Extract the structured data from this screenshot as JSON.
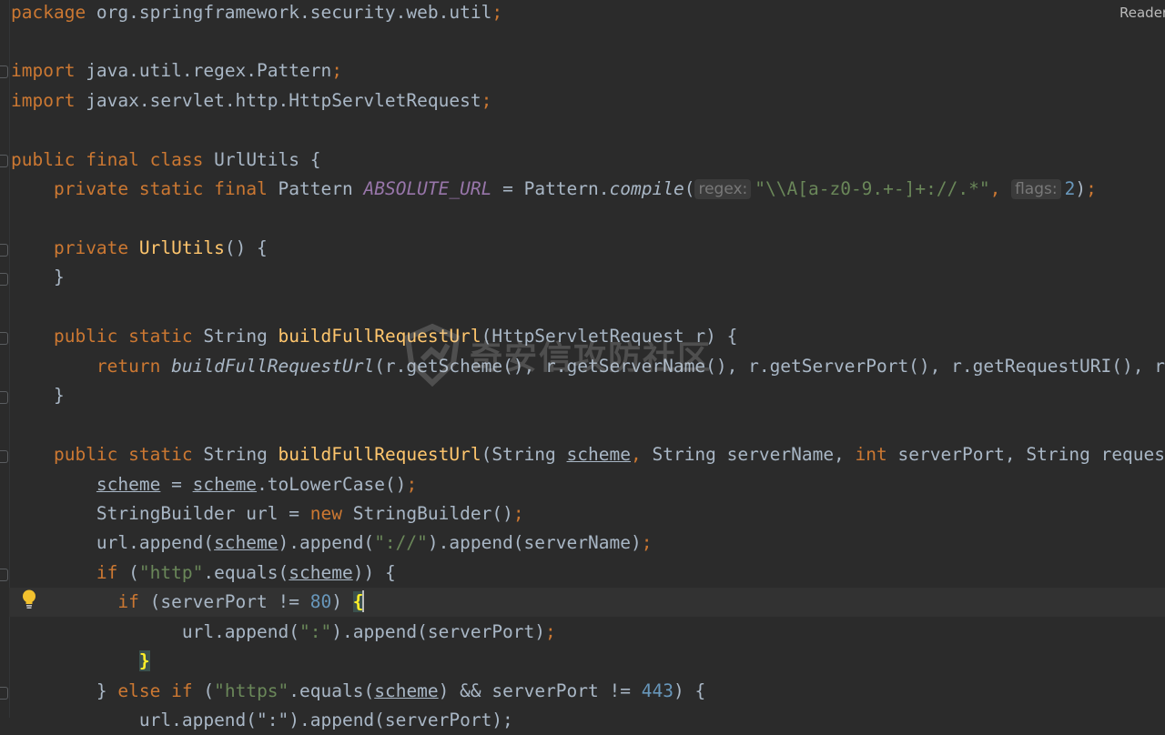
{
  "reader_mode": {
    "label": "Reader Mo"
  },
  "watermark": {
    "text": "奇安信攻防社区",
    "icon": "shield-logo-icon"
  },
  "hints": {
    "regex": "regex:",
    "flags": "flags:"
  },
  "code": {
    "package_kw": "package",
    "package_name": " org.springframework.security.web.util",
    "import_kw": "import",
    "import1": " java.util.regex.Pattern",
    "import2": " javax.servlet.http.HttpServletRequest",
    "public": "public",
    "final": "final",
    "class": "class",
    "class_name": " UrlUtils {",
    "private": "private",
    "static": "static",
    "pattern_type": " Pattern ",
    "absolute_url": "ABSOLUTE_URL",
    "eq_pattern": " = Pattern.",
    "compile": "compile",
    "regex_str": "\"\\\\A[a-z0-9.+-]+://.*\"",
    "flags_num": "2",
    "ctor_name": "UrlUtils",
    "ctor_rest": "() {",
    "close_brace": "}",
    "string_type": " String ",
    "method_name": "buildFullRequestUrl",
    "sig1_rest": "(HttpServletRequest r) {",
    "return": "return",
    "return_call": "buildFullRequestUrl",
    "return_args": "(r.getScheme(), r.getServerName(), r.getServerPort(), r.getRequestURI(), r",
    "sig2_a": "(String ",
    "scheme": "scheme",
    "sig2_b": " String serverName, ",
    "int": "int",
    "sig2_c": " serverPort, String reques",
    "eq": " = ",
    "to_lower": ".toLowerCase()",
    "sb_decl": "StringBuilder url = ",
    "new": "new",
    "sb_ctor": " StringBuilder()",
    "append_a": "url.append(",
    "append_b": ").append(",
    "colon_slashes": "\"://\"",
    "append_c": ").append(serverName)",
    "if": "if",
    "http": "\"http\"",
    "equals_open": ".equals(",
    "if_close": ")) {",
    "port_cond": " (serverPort != ",
    "port80": "80",
    "paren_close": ") ",
    "open_brace": "{",
    "colon": "\":\"",
    "append_port": ").append(serverPort)",
    "else": "else",
    "https": "\"https\"",
    "and_cond": ") && serverPort != ",
    "port443": "443",
    "brace_open_end": ") {",
    "last_line": "url.append(\":\").append(serverPort);"
  }
}
